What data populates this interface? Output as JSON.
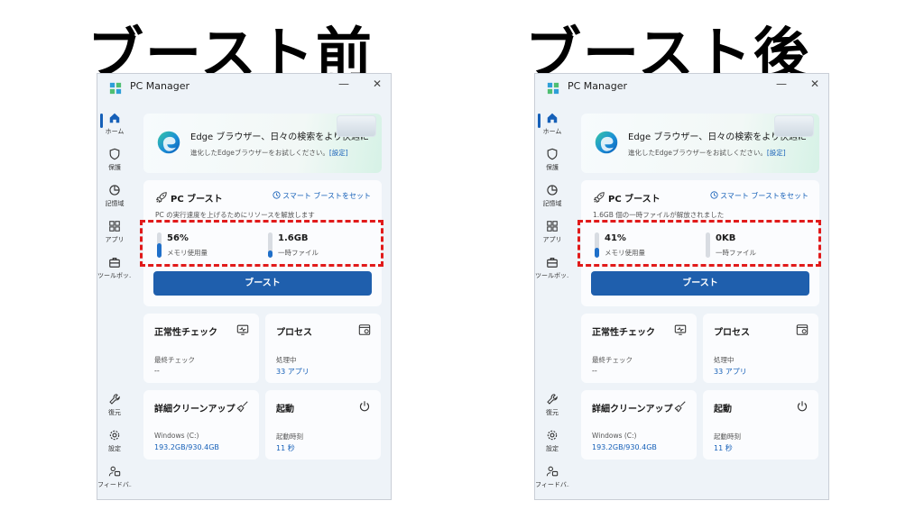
{
  "panels": [
    {
      "heading": "ブースト前",
      "app_title": "PC Manager",
      "window_controls": {
        "minimize": "—",
        "close": "✕"
      },
      "nav": [
        {
          "label": "ホーム",
          "icon": "home-icon"
        },
        {
          "label": "保護",
          "icon": "shield-icon"
        },
        {
          "label": "記憶域",
          "icon": "storage-pie-icon"
        },
        {
          "label": "アプリ",
          "icon": "apps-icon"
        },
        {
          "label": "ツールボッ...",
          "icon": "toolbox-icon"
        },
        {
          "label": "復元",
          "icon": "wrench-icon"
        },
        {
          "label": "設定",
          "icon": "gear-icon"
        },
        {
          "label": "フィードバ...",
          "icon": "feedback-icon"
        }
      ],
      "banner": {
        "title": "Edge ブラウザー、日々の検索をより快適に",
        "subtitle": "進化したEdgeブラウザーをお試しください。",
        "link": "[設定]"
      },
      "boost": {
        "title": "PC ブースト",
        "smart_boost": "スマート ブーストをセット",
        "description": "PC の実行速度を上げるためにリソースを解放します",
        "metrics": [
          {
            "value": "56%",
            "label": "メモリ使用量",
            "level": 0.56
          },
          {
            "value": "1.6GB",
            "label": "一時ファイル",
            "level": 0.3
          }
        ],
        "button": "ブースト"
      },
      "tiles": [
        {
          "title": "正常性チェック",
          "icon": "monitor-check-icon",
          "sub": "最終チェック",
          "value": "--",
          "link": false
        },
        {
          "title": "プロセス",
          "icon": "process-window-icon",
          "sub": "処理中",
          "value": "33 アプリ",
          "link": true
        },
        {
          "title": "詳細クリーンアップ",
          "icon": "broom-icon",
          "sub": "Windows (C:)",
          "value": "193.2GB/930.4GB",
          "link": true
        },
        {
          "title": "起動",
          "icon": "power-icon",
          "sub": "起動時刻",
          "value": "11 秒",
          "link": true
        }
      ]
    },
    {
      "heading": "ブースト後",
      "app_title": "PC Manager",
      "window_controls": {
        "minimize": "—",
        "close": "✕"
      },
      "nav": [
        {
          "label": "ホーム",
          "icon": "home-icon"
        },
        {
          "label": "保護",
          "icon": "shield-icon"
        },
        {
          "label": "記憶域",
          "icon": "storage-pie-icon"
        },
        {
          "label": "アプリ",
          "icon": "apps-icon"
        },
        {
          "label": "ツールボッ...",
          "icon": "toolbox-icon"
        },
        {
          "label": "復元",
          "icon": "wrench-icon"
        },
        {
          "label": "設定",
          "icon": "gear-icon"
        },
        {
          "label": "フィードバ...",
          "icon": "feedback-icon"
        }
      ],
      "banner": {
        "title": "Edge ブラウザー、日々の検索をより快適に",
        "subtitle": "進化したEdgeブラウザーをお試しください。",
        "link": "[設定]"
      },
      "boost": {
        "title": "PC ブースト",
        "smart_boost": "スマート ブーストをセット",
        "description": "1.6GB 個の一時ファイルが解放されました",
        "metrics": [
          {
            "value": "41%",
            "label": "メモリ使用量",
            "level": 0.41
          },
          {
            "value": "0KB",
            "label": "一時ファイル",
            "level": 0
          }
        ],
        "button": "ブースト"
      },
      "tiles": [
        {
          "title": "正常性チェック",
          "icon": "monitor-check-icon",
          "sub": "最終チェック",
          "value": "--",
          "link": false
        },
        {
          "title": "プロセス",
          "icon": "process-window-icon",
          "sub": "処理中",
          "value": "33 アプリ",
          "link": true
        },
        {
          "title": "詳細クリーンアップ",
          "icon": "broom-icon",
          "sub": "Windows (C:)",
          "value": "193.2GB/930.4GB",
          "link": true
        },
        {
          "title": "起動",
          "icon": "power-icon",
          "sub": "起動時刻",
          "value": "11 秒",
          "link": true
        }
      ]
    }
  ],
  "colors": {
    "accent": "#1660b8",
    "button": "#1f5fad",
    "highlight": "#e11a1a"
  }
}
